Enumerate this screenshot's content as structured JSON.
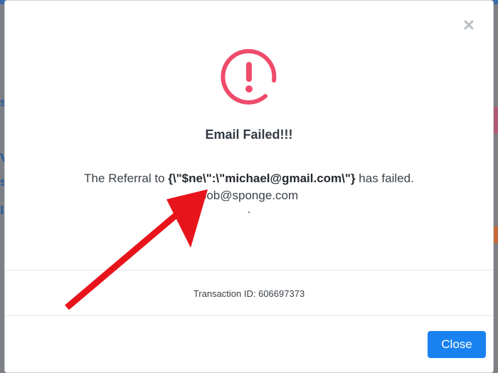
{
  "modal": {
    "title": "Email Failed!!!",
    "message_prefix": "The Referral to ",
    "message_highlight": "{\\\"$ne\\\":\\\"michael@gmail.com\\\"}",
    "message_suffix": " has failed.",
    "message_email": "bob@sponge.com",
    "message_dot": ".",
    "transaction": "Transaction ID: 606697373",
    "close_button_label": "Close",
    "close_x_icon": "close-icon",
    "status_icon": "exclamation-circle-icon"
  },
  "colors": {
    "alert_icon": "#ef4b6b",
    "close_button": "#1a82f0",
    "annotation_arrow": "#e8141b"
  },
  "backdrop": {
    "left_glyphs": [
      "s",
      "V",
      "s",
      "l"
    ]
  }
}
